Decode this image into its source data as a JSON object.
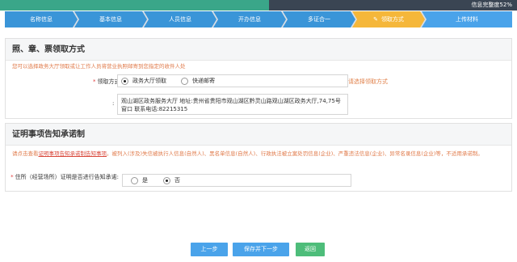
{
  "progress": {
    "label": "信息完整度52%",
    "percent": 52
  },
  "steps": [
    {
      "label": "名称信息",
      "state": "done"
    },
    {
      "label": "基本信息",
      "state": "done"
    },
    {
      "label": "人员信息",
      "state": "done"
    },
    {
      "label": "开办信息",
      "state": "done"
    },
    {
      "label": "多证合一",
      "state": "done"
    },
    {
      "label": "领取方式",
      "state": "current"
    },
    {
      "label": "上传材料",
      "state": "pending"
    }
  ],
  "colors": {
    "done": "#3a95d8",
    "current": "#f5b73a",
    "pending": "#4aa3ea",
    "note": "#e07a4a",
    "button_blue": "#4aa3ea",
    "button_green": "#4ebd7a"
  },
  "pickup": {
    "title": "照、章、票领取方式",
    "note": "您可以选择政务大厅领取或让工作人员将营业执照邮寄到您指定的收件人处",
    "method_label": "领取方式",
    "options": [
      "政务大厅领取",
      "快递邮寄"
    ],
    "selected": "政务大厅领取",
    "hint": "请选择领取方式",
    "address_label": ":",
    "address": "观山湖区政务服务大厅 地址:贵州省贵阳市观山湖区黔灵山路观山湖区政务大厅,74,75号窗口 联系电话:82215315"
  },
  "pledge": {
    "title": "证明事项告知承诺制",
    "notice_before": "请点击查看",
    "notice_link": "证明事项告知承诺制告知事项",
    "notice_after": "。被列入(涉及)失信被执行人信息(自然人)、黑名单信息(自然人)、行政执法被立案处罚信息(企业)、严重违法信息(企业)、异常名录信息(企业)等，不适用承诺制。",
    "question": "住所（经营场所）证明是否进行告知承诺:",
    "options": [
      "是",
      "否"
    ],
    "selected": "否"
  },
  "buttons": {
    "prev": "上一步",
    "save_next": "保存并下一步",
    "back": "返回"
  }
}
